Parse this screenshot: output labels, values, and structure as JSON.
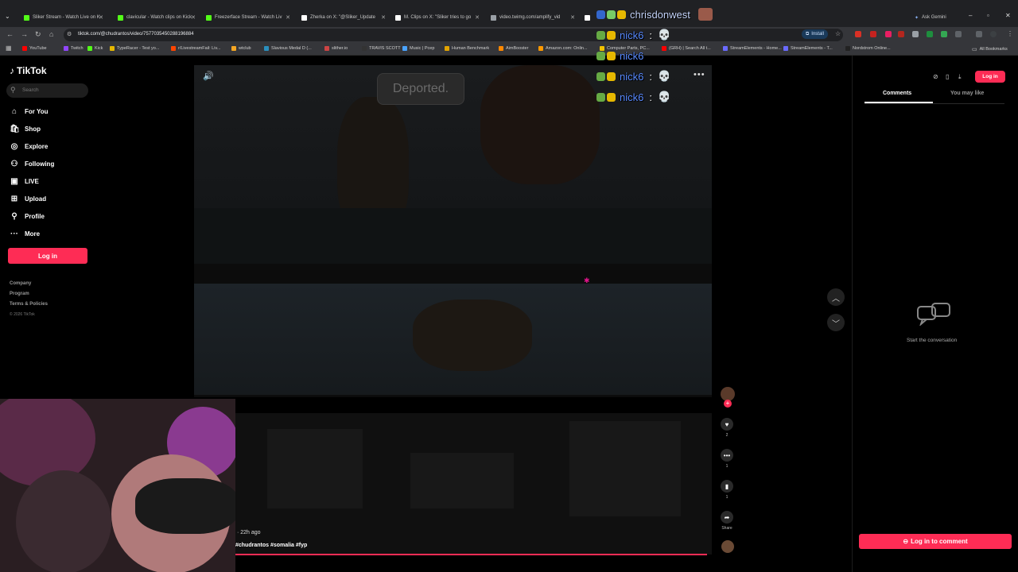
{
  "browser": {
    "tabs": [
      {
        "title": "Sliker Stream - Watch Live on K",
        "color": "#53fc18"
      },
      {
        "title": "clavicular - Watch clips on Kick",
        "color": "#53fc18"
      },
      {
        "title": "Freezerface Stream - Watch Liv",
        "color": "#53fc18"
      },
      {
        "title": "Zherka on X: \"@Sliker_Update",
        "color": "#ffffff"
      },
      {
        "title": "M. Clips on X: \"Sliker tries to go",
        "color": "#ffffff"
      },
      {
        "title": "video.twimg.com/amplify_vid",
        "color": "#9aa0a6"
      },
      {
        "title": "",
        "color": "#ffffff"
      }
    ],
    "ask_gemini": "Ask Gemini",
    "url": "tiktok.com/@chudrantos/video/7577035450288196884",
    "install_label": "Install",
    "bookmarks": [
      {
        "label": "YouTube",
        "color": "#ff0000"
      },
      {
        "label": "Twitch",
        "color": "#9146ff"
      },
      {
        "label": "Kick",
        "color": "#53fc18"
      },
      {
        "label": "TypeRacer - Test yo...",
        "color": "#e5b700"
      },
      {
        "label": "r/LivestreamFail: Liv...",
        "color": "#ff4500"
      },
      {
        "label": "wtclub",
        "color": "#f5a623"
      },
      {
        "label": "Slavious Medal D (...",
        "color": "#2a8fbd"
      },
      {
        "label": "slither.io",
        "color": "#c44"
      },
      {
        "label": "TRAVIS SCOTT",
        "color": "#333"
      },
      {
        "label": "Music | Pcep",
        "color": "#4aa3ff"
      },
      {
        "label": "Human Benchmark",
        "color": "#e2a400"
      },
      {
        "label": "AimBooster",
        "color": "#ff8800"
      },
      {
        "label": "Amazon.com: Onlin...",
        "color": "#ff9900"
      },
      {
        "label": "Computer Parts, PC...",
        "color": "#f2c200"
      },
      {
        "label": "(GRH) | Search All t...",
        "color": "#ff0000"
      },
      {
        "label": "StreamElements - Home...",
        "color": "#6a6aff"
      },
      {
        "label": "StreamElements - T...",
        "color": "#6a6aff"
      },
      {
        "label": "Nordstrom Online...",
        "color": "#222"
      }
    ],
    "all_bookmarks": "All Bookmarks"
  },
  "sidebar": {
    "logo": "TikTok",
    "search_placeholder": "Search",
    "items": [
      {
        "label": "For You",
        "icon": "home-icon"
      },
      {
        "label": "Shop",
        "icon": "shop-icon"
      },
      {
        "label": "Explore",
        "icon": "compass-icon"
      },
      {
        "label": "Following",
        "icon": "person-icon"
      },
      {
        "label": "LIVE",
        "icon": "live-icon"
      },
      {
        "label": "Upload",
        "icon": "upload-icon"
      },
      {
        "label": "Profile",
        "icon": "profile-icon"
      },
      {
        "label": "More",
        "icon": "more-dots-icon"
      }
    ],
    "login": "Log in",
    "footer": [
      "Company",
      "Program",
      "Terms & Policies"
    ],
    "copyright": "© 2026 TikTok"
  },
  "video": {
    "bubble_text": "Deported.",
    "posted": "· 22h ago",
    "hashtags": "#chudrantos #somalia #fyp",
    "progress": 0.99
  },
  "rail": {
    "likes": "2",
    "comments": "1",
    "saves": "1",
    "share": "Share"
  },
  "comments": {
    "tab_comments": "Comments",
    "tab_may_like": "You may like",
    "login": "Log in",
    "empty": "Start the conversation",
    "login_to_comment": "Log in to comment"
  },
  "chat": [
    {
      "name": "chrisdonwest"
    },
    {
      "name": "nick6",
      "msg": "💀"
    },
    {
      "name": "nick6",
      "msg": ""
    },
    {
      "name": "nick6",
      "msg": "💀"
    },
    {
      "name": "nick6",
      "msg": "💀"
    }
  ]
}
